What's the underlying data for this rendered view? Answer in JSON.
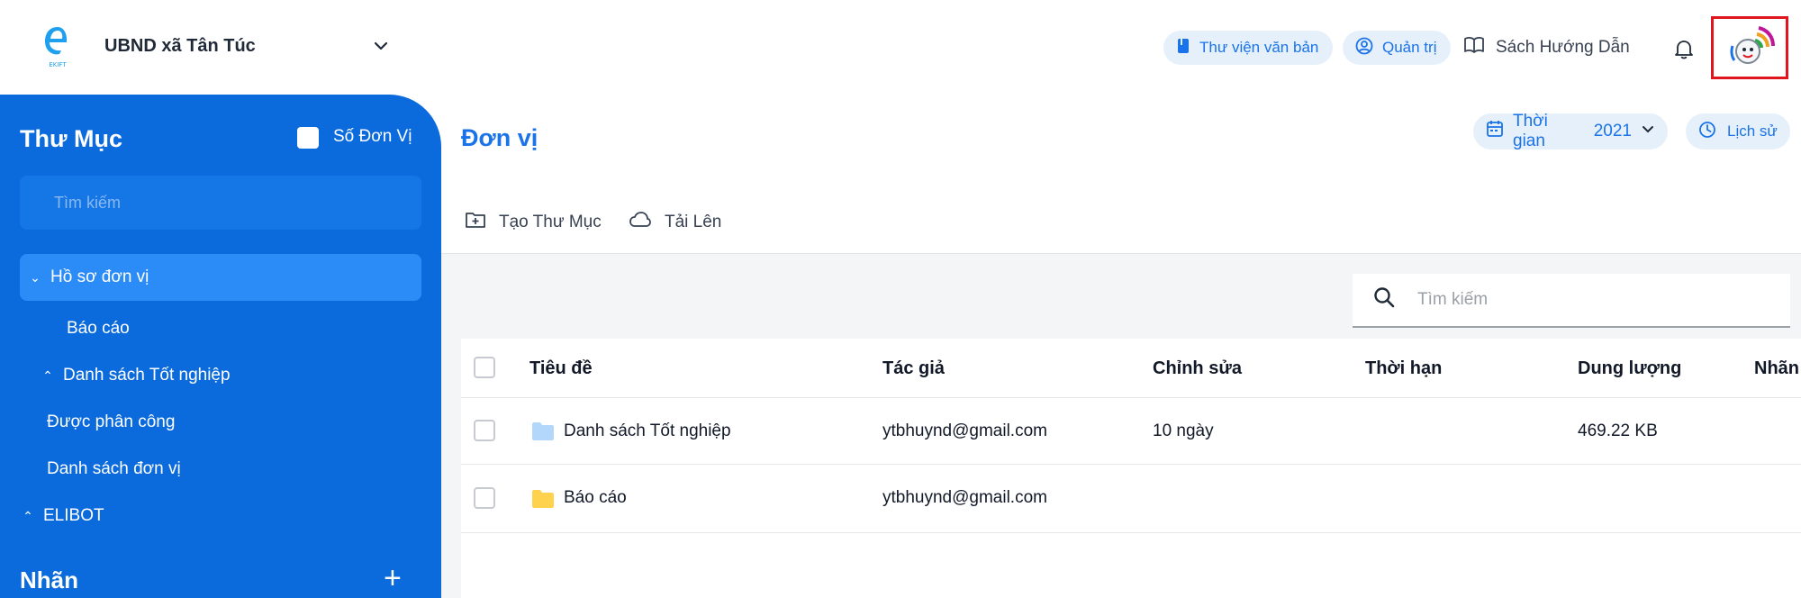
{
  "header": {
    "org_name": "UBND xã Tân Túc",
    "library_label": "Thư viện văn bản",
    "admin_label": "Quản trị",
    "guide_label": "Sách Hướng Dẫn",
    "logo_text": "EKIFT"
  },
  "sidebar": {
    "title": "Thư Mục",
    "unit_toggle_label": "Số Đơn Vị",
    "search_placeholder": "Tìm kiếm",
    "items": [
      {
        "label": "Hồ sơ đơn vị",
        "caret": "⌄"
      },
      {
        "label": "Báo cáo"
      },
      {
        "label": "Danh sách Tốt nghiệp",
        "caret": "⌃"
      },
      {
        "label": "Được phân công"
      },
      {
        "label": "Danh sách đơn vị"
      },
      {
        "label": "ELIBOT",
        "caret": "⌃"
      }
    ],
    "labels_title": "Nhãn",
    "add_symbol": "+"
  },
  "main": {
    "title": "Đơn vị",
    "time_label": "Thời gian",
    "year": "2021",
    "history_label": "Lịch sử",
    "create_folder_label": "Tạo Thư Mục",
    "upload_label": "Tải Lên",
    "search_placeholder": "Tìm kiếm"
  },
  "table": {
    "columns": [
      "Tiêu đề",
      "Tác giả",
      "Chỉnh sửa",
      "Thời hạn",
      "Dung lượng",
      "Nhãn"
    ],
    "rows": [
      {
        "title": "Danh sách Tốt nghiệp",
        "author": "ytbhuynd@gmail.com",
        "edited": "10 ngày",
        "deadline": "",
        "size": "469.22 KB",
        "folder_color": "#b3d7fb"
      },
      {
        "title": "Báo cáo",
        "author": "ytbhuynd@gmail.com",
        "edited": "",
        "deadline": "",
        "size": "",
        "folder_color": "#ffd24d"
      }
    ]
  },
  "colors": {
    "primary": "#1a73e8",
    "sidebar": "#0b6bdc",
    "sidebar_active": "#2b8cf7",
    "highlight_border": "#e0161f"
  }
}
